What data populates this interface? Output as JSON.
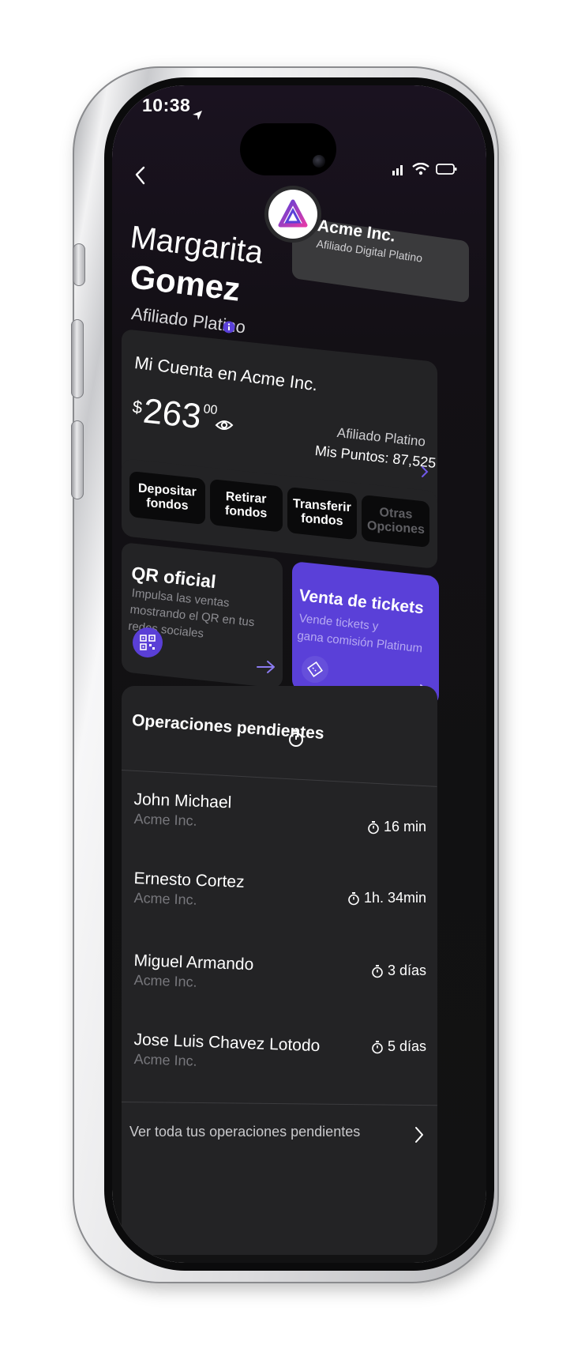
{
  "status_bar": {
    "time": "10:38"
  },
  "header": {
    "org_name": "Acme Inc.",
    "org_tier": "Afiliado Digital Platino"
  },
  "user": {
    "first_name": "Margarita",
    "last_name": "Gomez",
    "tier": "Afiliado Platino"
  },
  "account": {
    "title": "Mi Cuenta en Acme Inc.",
    "currency_symbol": "$",
    "balance_int": "263",
    "balance_dec": "00",
    "tier": "Afiliado Platino",
    "points": "Mis Puntos: 87,525"
  },
  "actions": [
    {
      "line1": "Depositar",
      "line2": "fondos"
    },
    {
      "line1": "Retirar",
      "line2": "fondos"
    },
    {
      "line1": "Transferir",
      "line2": "fondos"
    },
    {
      "line1": "Otras",
      "line2": "Opciones"
    }
  ],
  "qr_card": {
    "title": "QR oficial",
    "description": "Impulsa las ventas mostrando el QR en tus redes sociales"
  },
  "tickets_card": {
    "title": "Venta de tickets",
    "description_line1": "Vende tickets y",
    "description_line2": "gana comisión Platinum"
  },
  "pending": {
    "title": "Operaciones pendientes",
    "items": [
      {
        "name": "John Michael",
        "org": "Acme Inc.",
        "time": "16 min"
      },
      {
        "name": "Ernesto Cortez",
        "org": "Acme Inc.",
        "time": "1h. 34min"
      },
      {
        "name": "Miguel Armando",
        "org": "Acme Inc.",
        "time": "3 días"
      },
      {
        "name": "Jose Luis Chavez Lotodo",
        "org": "Acme Inc.",
        "time": "5 días"
      }
    ],
    "see_all_label": "Ver toda tus operaciones pendientes"
  },
  "colors": {
    "accent": "#5a40d8",
    "card_bg": "#232325",
    "screen_bg": "#121213"
  }
}
